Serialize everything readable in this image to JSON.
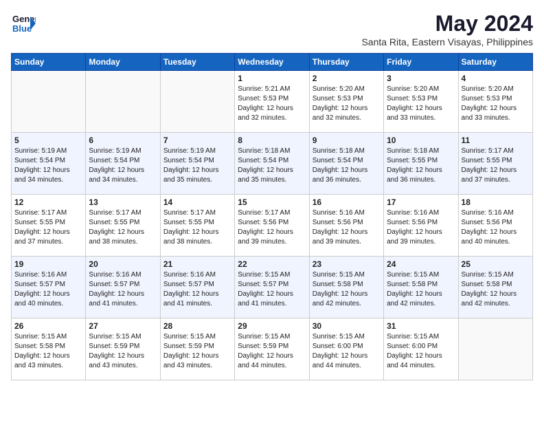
{
  "logo": {
    "line1": "General",
    "line2": "Blue"
  },
  "title": "May 2024",
  "location": "Santa Rita, Eastern Visayas, Philippines",
  "days_header": [
    "Sunday",
    "Monday",
    "Tuesday",
    "Wednesday",
    "Thursday",
    "Friday",
    "Saturday"
  ],
  "weeks": [
    [
      {
        "day": "",
        "info": ""
      },
      {
        "day": "",
        "info": ""
      },
      {
        "day": "",
        "info": ""
      },
      {
        "day": "1",
        "info": "Sunrise: 5:21 AM\nSunset: 5:53 PM\nDaylight: 12 hours\nand 32 minutes."
      },
      {
        "day": "2",
        "info": "Sunrise: 5:20 AM\nSunset: 5:53 PM\nDaylight: 12 hours\nand 32 minutes."
      },
      {
        "day": "3",
        "info": "Sunrise: 5:20 AM\nSunset: 5:53 PM\nDaylight: 12 hours\nand 33 minutes."
      },
      {
        "day": "4",
        "info": "Sunrise: 5:20 AM\nSunset: 5:53 PM\nDaylight: 12 hours\nand 33 minutes."
      }
    ],
    [
      {
        "day": "5",
        "info": "Sunrise: 5:19 AM\nSunset: 5:54 PM\nDaylight: 12 hours\nand 34 minutes."
      },
      {
        "day": "6",
        "info": "Sunrise: 5:19 AM\nSunset: 5:54 PM\nDaylight: 12 hours\nand 34 minutes."
      },
      {
        "day": "7",
        "info": "Sunrise: 5:19 AM\nSunset: 5:54 PM\nDaylight: 12 hours\nand 35 minutes."
      },
      {
        "day": "8",
        "info": "Sunrise: 5:18 AM\nSunset: 5:54 PM\nDaylight: 12 hours\nand 35 minutes."
      },
      {
        "day": "9",
        "info": "Sunrise: 5:18 AM\nSunset: 5:54 PM\nDaylight: 12 hours\nand 36 minutes."
      },
      {
        "day": "10",
        "info": "Sunrise: 5:18 AM\nSunset: 5:55 PM\nDaylight: 12 hours\nand 36 minutes."
      },
      {
        "day": "11",
        "info": "Sunrise: 5:17 AM\nSunset: 5:55 PM\nDaylight: 12 hours\nand 37 minutes."
      }
    ],
    [
      {
        "day": "12",
        "info": "Sunrise: 5:17 AM\nSunset: 5:55 PM\nDaylight: 12 hours\nand 37 minutes."
      },
      {
        "day": "13",
        "info": "Sunrise: 5:17 AM\nSunset: 5:55 PM\nDaylight: 12 hours\nand 38 minutes."
      },
      {
        "day": "14",
        "info": "Sunrise: 5:17 AM\nSunset: 5:55 PM\nDaylight: 12 hours\nand 38 minutes."
      },
      {
        "day": "15",
        "info": "Sunrise: 5:17 AM\nSunset: 5:56 PM\nDaylight: 12 hours\nand 39 minutes."
      },
      {
        "day": "16",
        "info": "Sunrise: 5:16 AM\nSunset: 5:56 PM\nDaylight: 12 hours\nand 39 minutes."
      },
      {
        "day": "17",
        "info": "Sunrise: 5:16 AM\nSunset: 5:56 PM\nDaylight: 12 hours\nand 39 minutes."
      },
      {
        "day": "18",
        "info": "Sunrise: 5:16 AM\nSunset: 5:56 PM\nDaylight: 12 hours\nand 40 minutes."
      }
    ],
    [
      {
        "day": "19",
        "info": "Sunrise: 5:16 AM\nSunset: 5:57 PM\nDaylight: 12 hours\nand 40 minutes."
      },
      {
        "day": "20",
        "info": "Sunrise: 5:16 AM\nSunset: 5:57 PM\nDaylight: 12 hours\nand 41 minutes."
      },
      {
        "day": "21",
        "info": "Sunrise: 5:16 AM\nSunset: 5:57 PM\nDaylight: 12 hours\nand 41 minutes."
      },
      {
        "day": "22",
        "info": "Sunrise: 5:15 AM\nSunset: 5:57 PM\nDaylight: 12 hours\nand 41 minutes."
      },
      {
        "day": "23",
        "info": "Sunrise: 5:15 AM\nSunset: 5:58 PM\nDaylight: 12 hours\nand 42 minutes."
      },
      {
        "day": "24",
        "info": "Sunrise: 5:15 AM\nSunset: 5:58 PM\nDaylight: 12 hours\nand 42 minutes."
      },
      {
        "day": "25",
        "info": "Sunrise: 5:15 AM\nSunset: 5:58 PM\nDaylight: 12 hours\nand 42 minutes."
      }
    ],
    [
      {
        "day": "26",
        "info": "Sunrise: 5:15 AM\nSunset: 5:58 PM\nDaylight: 12 hours\nand 43 minutes."
      },
      {
        "day": "27",
        "info": "Sunrise: 5:15 AM\nSunset: 5:59 PM\nDaylight: 12 hours\nand 43 minutes."
      },
      {
        "day": "28",
        "info": "Sunrise: 5:15 AM\nSunset: 5:59 PM\nDaylight: 12 hours\nand 43 minutes."
      },
      {
        "day": "29",
        "info": "Sunrise: 5:15 AM\nSunset: 5:59 PM\nDaylight: 12 hours\nand 44 minutes."
      },
      {
        "day": "30",
        "info": "Sunrise: 5:15 AM\nSunset: 6:00 PM\nDaylight: 12 hours\nand 44 minutes."
      },
      {
        "day": "31",
        "info": "Sunrise: 5:15 AM\nSunset: 6:00 PM\nDaylight: 12 hours\nand 44 minutes."
      },
      {
        "day": "",
        "info": ""
      }
    ]
  ]
}
